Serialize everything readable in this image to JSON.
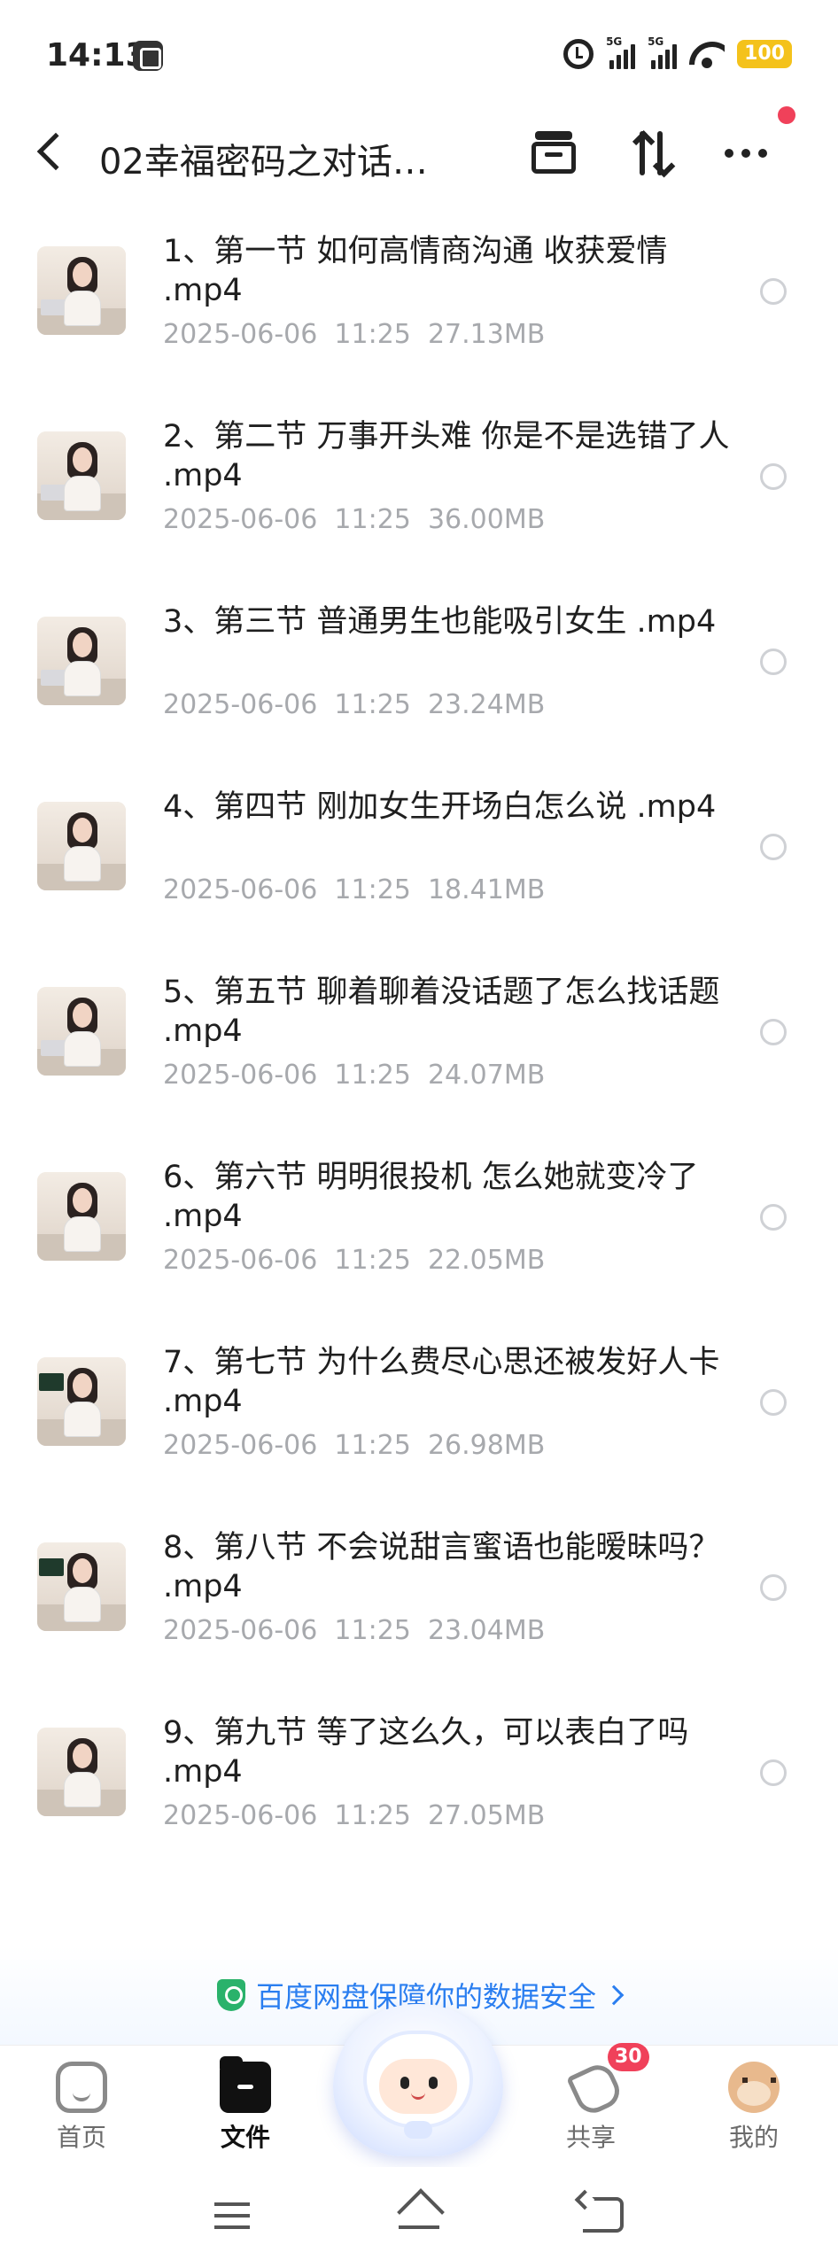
{
  "status_bar": {
    "time": "14:13",
    "network_1": "5G",
    "network_2": "5G",
    "battery": "100"
  },
  "header": {
    "title": "02幸福密码之对话…",
    "back_icon": "chevron-left-icon",
    "archive_icon": "archive-icon",
    "sort_icon": "sort-icon",
    "more_icon": "more-icon"
  },
  "files": [
    {
      "name": "1、第一节 如何高情商沟通 收获爱情 .mp4",
      "date": "2025-06-06  11:25",
      "size": "27.13MB"
    },
    {
      "name": "2、第二节  万事开头难  你是不是选错了人 .mp4",
      "date": "2025-06-06  11:25",
      "size": "36.00MB"
    },
    {
      "name": "3、第三节 普通男生也能吸引女生 .mp4",
      "date": "2025-06-06  11:25",
      "size": "23.24MB"
    },
    {
      "name": "4、第四节 刚加女生开场白怎么说 .mp4",
      "date": "2025-06-06  11:25",
      "size": "18.41MB"
    },
    {
      "name": "5、第五节  聊着聊着没话题了怎么找话题 .mp4",
      "date": "2025-06-06  11:25",
      "size": "24.07MB"
    },
    {
      "name": "6、第六节 明明很投机 怎么她就变冷了 .mp4",
      "date": "2025-06-06  11:25",
      "size": "22.05MB"
    },
    {
      "name": "7、第七节 为什么费尽心思还被发好人卡 .mp4",
      "date": "2025-06-06  11:25",
      "size": "26.98MB"
    },
    {
      "name": "8、第八节 不会说甜言蜜语也能暧昧吗？ .mp4",
      "date": "2025-06-06  11:25",
      "size": "23.04MB"
    },
    {
      "name": "9、第九节 等了这么久，可以表白了吗 .mp4",
      "date": "2025-06-06  11:25",
      "size": "27.05MB"
    }
  ],
  "security_banner": {
    "text": "百度网盘保障你的数据安全",
    "icon": "shield-icon"
  },
  "bottom_nav": {
    "items": [
      {
        "label": "首页",
        "icon": "home-icon",
        "active": false
      },
      {
        "label": "文件",
        "icon": "folder-icon",
        "active": true
      },
      {
        "label": "共享",
        "icon": "send-icon",
        "active": false,
        "badge": "30"
      },
      {
        "label": "我的",
        "icon": "avatar-icon",
        "active": false
      }
    ]
  },
  "colors": {
    "accent": "#2a7ef0",
    "badge": "#f0415a",
    "meta_text": "#a7a9ad",
    "battery": "#f4c21b"
  }
}
